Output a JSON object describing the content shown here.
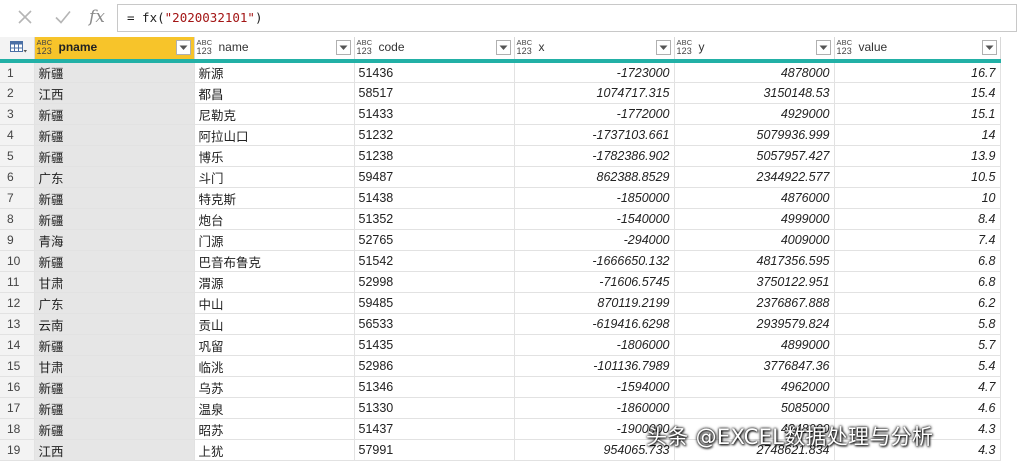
{
  "formula_bar": {
    "cancel_icon": "close-icon",
    "confirm_icon": "check-icon",
    "fx_label": "fx",
    "formula_prefix": "= fx(",
    "formula_string": "\"2020032101\"",
    "formula_suffix": ")"
  },
  "table": {
    "type_badge_top": "ABC",
    "type_badge_bottom": "123",
    "columns": [
      {
        "key": "pname",
        "label": "pname",
        "selected": true
      },
      {
        "key": "name",
        "label": "name"
      },
      {
        "key": "code",
        "label": "code"
      },
      {
        "key": "x",
        "label": "x"
      },
      {
        "key": "y",
        "label": "y"
      },
      {
        "key": "value",
        "label": "value"
      }
    ],
    "rows": [
      [
        "1",
        "新疆",
        "新源",
        "51436",
        "-1723000",
        "4878000",
        "16.7"
      ],
      [
        "2",
        "江西",
        "都昌",
        "58517",
        "1074717.315",
        "3150148.53",
        "15.4"
      ],
      [
        "3",
        "新疆",
        "尼勒克",
        "51433",
        "-1772000",
        "4929000",
        "15.1"
      ],
      [
        "4",
        "新疆",
        "阿拉山口",
        "51232",
        "-1737103.661",
        "5079936.999",
        "14"
      ],
      [
        "5",
        "新疆",
        "博乐",
        "51238",
        "-1782386.902",
        "5057957.427",
        "13.9"
      ],
      [
        "6",
        "广东",
        "斗门",
        "59487",
        "862388.8529",
        "2344922.577",
        "10.5"
      ],
      [
        "7",
        "新疆",
        "特克斯",
        "51438",
        "-1850000",
        "4876000",
        "10"
      ],
      [
        "8",
        "新疆",
        "炮台",
        "51352",
        "-1540000",
        "4999000",
        "8.4"
      ],
      [
        "9",
        "青海",
        "门源",
        "52765",
        "-294000",
        "4009000",
        "7.4"
      ],
      [
        "10",
        "新疆",
        "巴音布鲁克",
        "51542",
        "-1666650.132",
        "4817356.595",
        "6.8"
      ],
      [
        "11",
        "甘肃",
        "渭源",
        "52998",
        "-71606.5745",
        "3750122.951",
        "6.8"
      ],
      [
        "12",
        "广东",
        "中山",
        "59485",
        "870119.2199",
        "2376867.888",
        "6.2"
      ],
      [
        "13",
        "云南",
        "贡山",
        "56533",
        "-619416.6298",
        "2939579.824",
        "5.8"
      ],
      [
        "14",
        "新疆",
        "巩留",
        "51435",
        "-1806000",
        "4899000",
        "5.7"
      ],
      [
        "15",
        "甘肃",
        "临洮",
        "52986",
        "-101136.7989",
        "3776847.36",
        "5.4"
      ],
      [
        "16",
        "新疆",
        "乌苏",
        "51346",
        "-1594000",
        "4962000",
        "4.7"
      ],
      [
        "17",
        "新疆",
        "温泉",
        "51330",
        "-1860000",
        "5085000",
        "4.6"
      ],
      [
        "18",
        "新疆",
        "昭苏",
        "51437",
        "-1900000",
        "4848000",
        "4.3"
      ],
      [
        "19",
        "江西",
        "上犹",
        "57991",
        "954065.733",
        "2748621.834",
        "4.3"
      ]
    ]
  },
  "watermark": "头条 @EXCEL数据处理与分析"
}
